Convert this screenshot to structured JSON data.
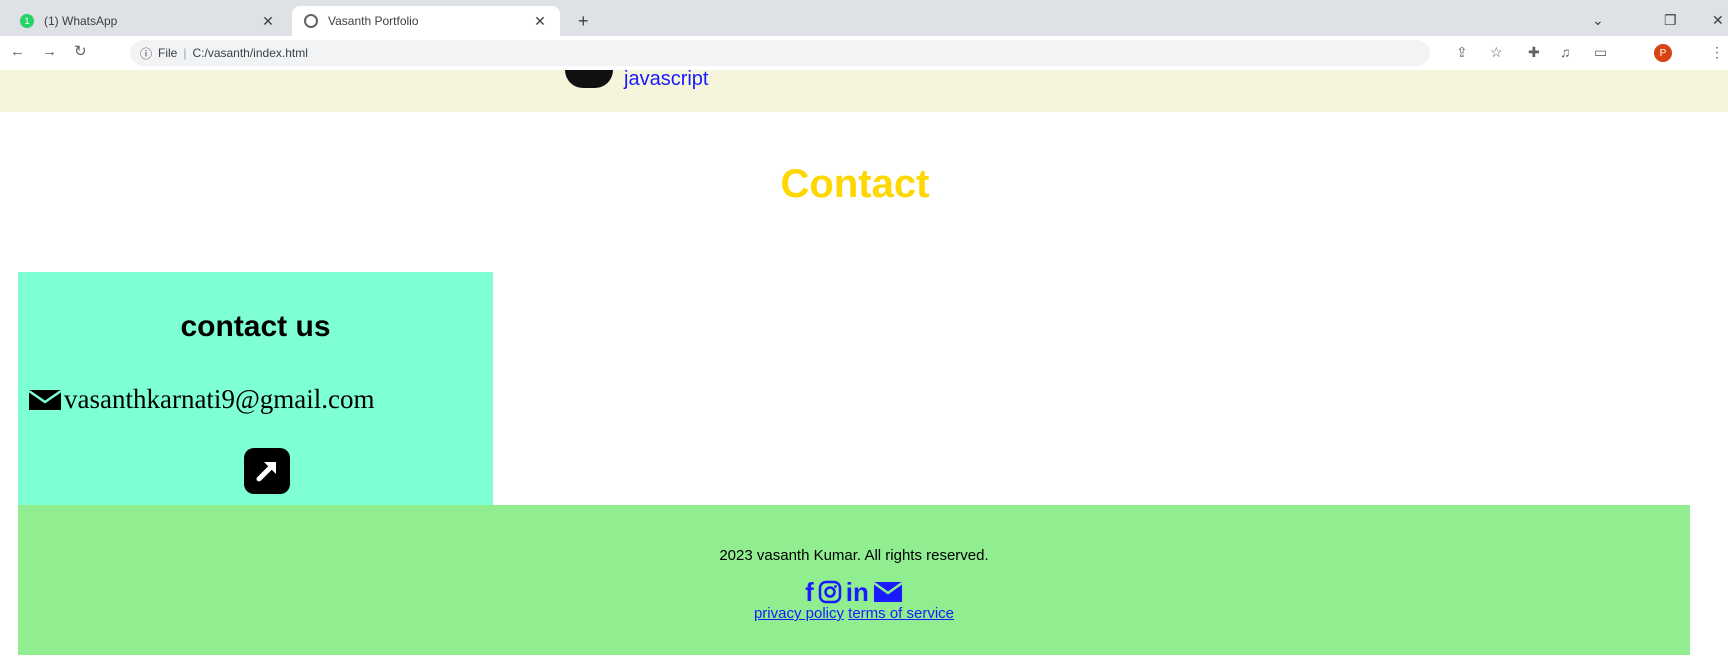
{
  "browser": {
    "tabs": [
      {
        "title": "(1) WhatsApp",
        "active": false,
        "favicon": "whatsapp-icon"
      },
      {
        "title": "Vasanth Portfolio",
        "active": true,
        "favicon": "globe-icon"
      }
    ],
    "new_tab_symbol": "+",
    "address": {
      "scheme_label": "File",
      "path": "C:/vasanth/index.html"
    },
    "profile_initial": "P",
    "profile_color": "#d84315"
  },
  "page": {
    "skills_strip": {
      "label": "javascript",
      "background": "#f5f5dc"
    },
    "contact_heading": "Contact",
    "contact_heading_color": "#ffd700",
    "contact_card": {
      "title": "contact us",
      "email": "vasanthkarnati9@gmail.com",
      "email_icon": "envelope-icon",
      "link_icon": "external-link-icon",
      "background": "#7fffd4"
    },
    "footer": {
      "copyright": "2023 vasanth Kumar. All rights reserved.",
      "social": [
        {
          "icon": "facebook-icon",
          "glyph": "f"
        },
        {
          "icon": "instagram-icon",
          "glyph": ""
        },
        {
          "icon": "linkedin-icon",
          "glyph": "in"
        },
        {
          "icon": "mail-icon",
          "glyph": ""
        }
      ],
      "links": [
        "privacy policy",
        "terms of service"
      ],
      "background": "#90ee90"
    }
  }
}
